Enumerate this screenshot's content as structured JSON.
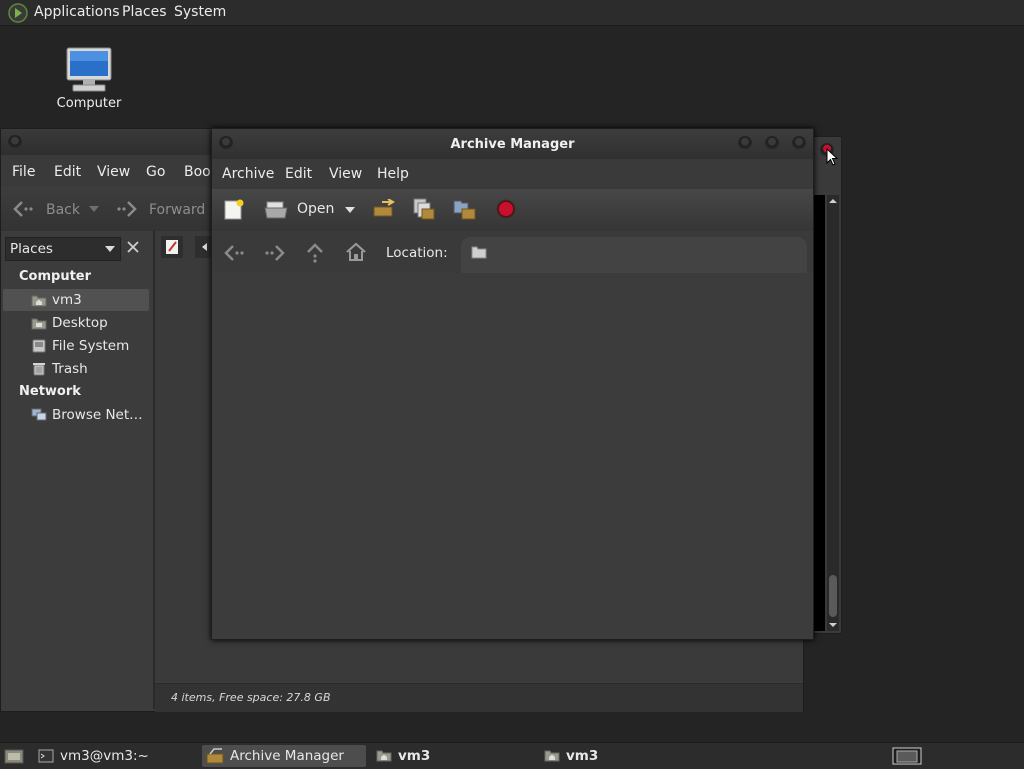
{
  "top_panel": {
    "menus": [
      "Applications",
      "Places",
      "System"
    ]
  },
  "desktop": {
    "computer_label": "Computer"
  },
  "file_manager": {
    "menus": [
      "File",
      "Edit",
      "View",
      "Go",
      "Book"
    ],
    "toolbar": {
      "back": "Back",
      "forward": "Forward"
    },
    "places_combo": "Places",
    "sidebar": {
      "computer_header": "Computer",
      "computer_items": [
        "vm3",
        "Desktop",
        "File System",
        "Trash"
      ],
      "network_header": "Network",
      "network_items": [
        "Browse Net…"
      ]
    },
    "status": "4 items, Free space: 27.8 GB"
  },
  "archive_manager": {
    "title": "Archive Manager",
    "menus": [
      "Archive",
      "Edit",
      "View",
      "Help"
    ],
    "toolbar": {
      "open_label": "Open"
    },
    "location_label": "Location:"
  },
  "taskbar": {
    "tasks": [
      "vm3@vm3:~",
      "Archive Manager",
      "vm3",
      "vm3"
    ]
  },
  "colors": {
    "panel": "#2c2c2c",
    "window": "#3a3a3a",
    "selection": "#515151",
    "stop_red": "#c8102e"
  }
}
